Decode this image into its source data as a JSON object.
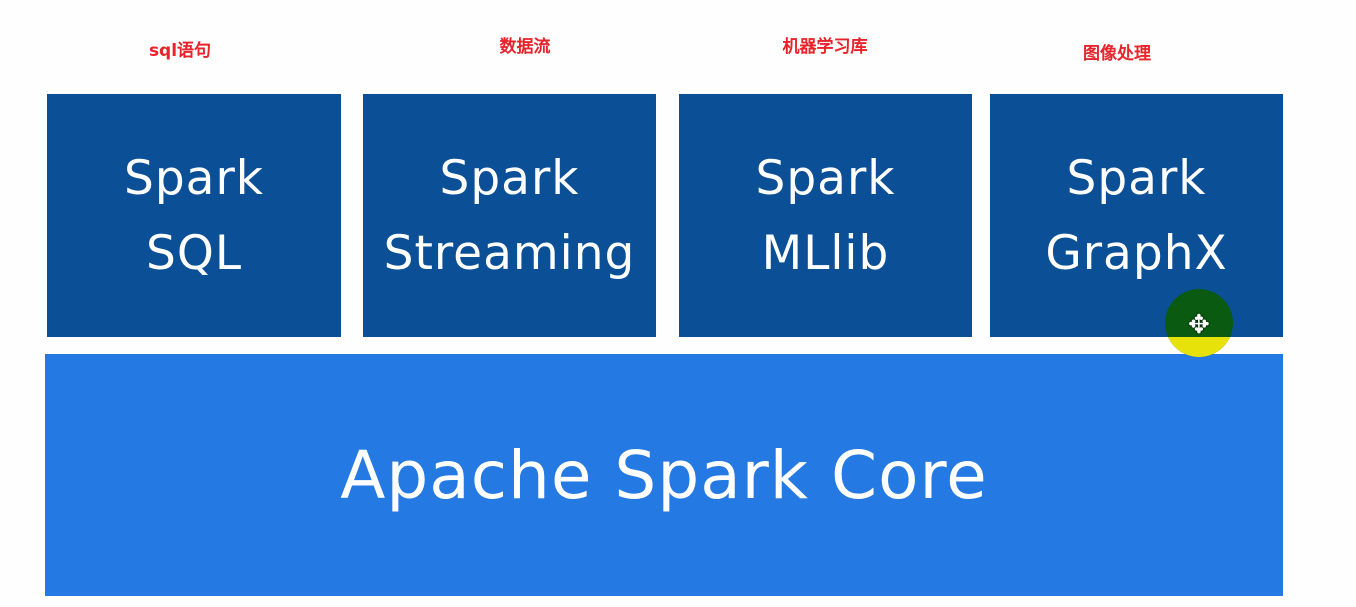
{
  "annotations": [
    "sql语句",
    "数据流",
    "机器学习库",
    "图像处理"
  ],
  "modules": [
    {
      "line1": "Spark",
      "line2": "SQL"
    },
    {
      "line1": "Spark",
      "line2": "Streaming"
    },
    {
      "line1": "Spark",
      "line2": "MLlib"
    },
    {
      "line1": "Spark",
      "line2": "GraphX"
    }
  ],
  "core": "Apache Spark Core",
  "colors": {
    "module": "#0b4f97",
    "core": "#2479e3",
    "annotation": "#e8232b"
  }
}
